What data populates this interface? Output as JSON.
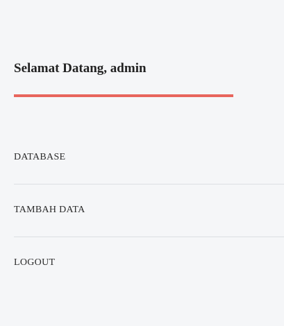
{
  "sidebar": {
    "welcome_text": "Selamat Datang, admin",
    "accent_color": "#e8655d",
    "background_color": "#f5f6f8",
    "menu": [
      {
        "label": "DATABASE"
      },
      {
        "label": "TAMBAH DATA"
      },
      {
        "label": "LOGOUT"
      }
    ]
  }
}
